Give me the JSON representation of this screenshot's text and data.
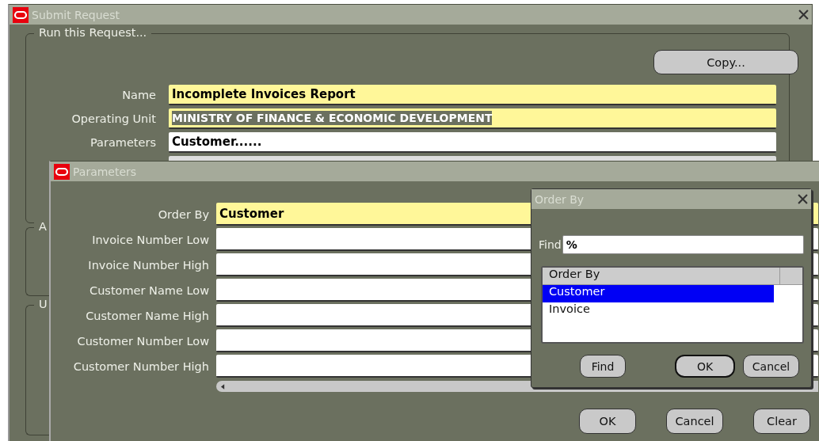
{
  "main_window": {
    "title": "Submit Request",
    "copy_button": "Copy...",
    "group_title": "Run this Request...",
    "fields": [
      {
        "label": "Name",
        "value": "Incomplete Invoices Report",
        "required": true,
        "selected": false
      },
      {
        "label": "Operating Unit",
        "value": "MINISTRY OF FINANCE & ECONOMIC DEVELOPMENT",
        "required": true,
        "selected": true
      },
      {
        "label": "Parameters",
        "value": "Customer......",
        "required": false,
        "selected": false
      }
    ],
    "other_groups": [
      "A",
      "U"
    ]
  },
  "parameters_window": {
    "title": "Parameters",
    "fields": [
      {
        "label": "Order By",
        "value": "Customer",
        "required": true
      },
      {
        "label": "Invoice Number Low",
        "required": false
      },
      {
        "label": "Invoice Number High",
        "required": false
      },
      {
        "label": "Customer Name Low",
        "required": false
      },
      {
        "label": "Customer Name High",
        "required": false
      },
      {
        "label": "Customer Number Low",
        "required": false
      },
      {
        "label": "Customer Number High",
        "required": false
      }
    ],
    "buttons": [
      "OK",
      "Cancel",
      "Clear"
    ]
  },
  "order_by_window": {
    "title": "Order By",
    "find_label": "Find",
    "find_value": "%",
    "list_header": "Order By",
    "items": [
      {
        "label": "Customer",
        "selected": true
      },
      {
        "label": "Invoice",
        "selected": false
      }
    ],
    "buttons": [
      {
        "label": "Find",
        "default": false
      },
      {
        "label": "OK",
        "default": true
      },
      {
        "label": "Cancel",
        "default": false
      }
    ]
  }
}
